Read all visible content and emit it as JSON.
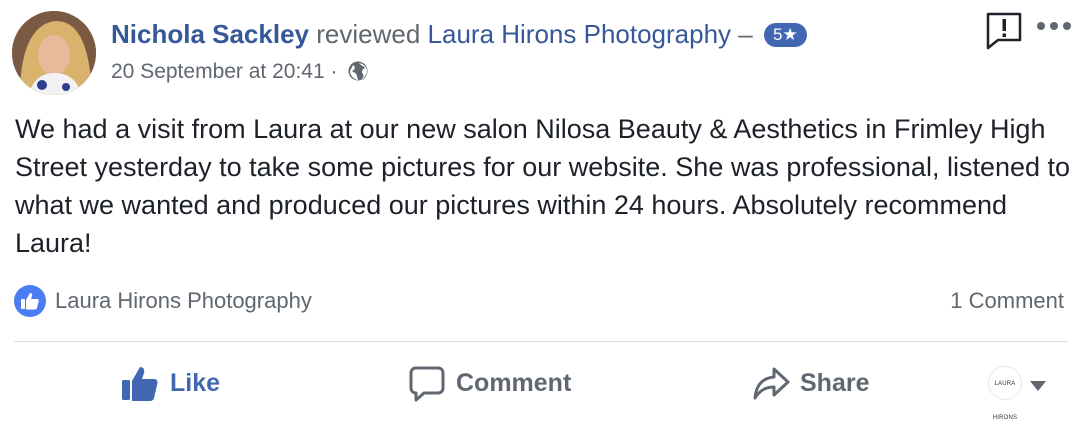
{
  "post": {
    "author": "Nichola Sackley",
    "verb": "reviewed",
    "page": "Laura Hirons Photography",
    "dash": " –",
    "rating": "5★",
    "timestamp": "20 September at 20:41",
    "separator": "·",
    "privacy_icon": "globe-icon",
    "body": "We had a visit from Laura at our new salon Nilosa Beauty & Aesthetics in Frimley High Street yesterday to take some pictures for our website. She was professional, listened to what we wanted and produced our pictures within 24 hours. Absolutely recommend Laura!"
  },
  "reactions": {
    "icon": "thumbs-up-icon",
    "likers": "Laura Hirons Photography",
    "comments": "1 Comment"
  },
  "actions": {
    "like": "Like",
    "comment": "Comment",
    "share": "Share"
  },
  "page_avatar_text": "LAURA HIRONS",
  "colors": {
    "link": "#365899",
    "accent": "#4267b2",
    "muted": "#606770",
    "text": "#1d2129",
    "divider": "#dadde1"
  }
}
